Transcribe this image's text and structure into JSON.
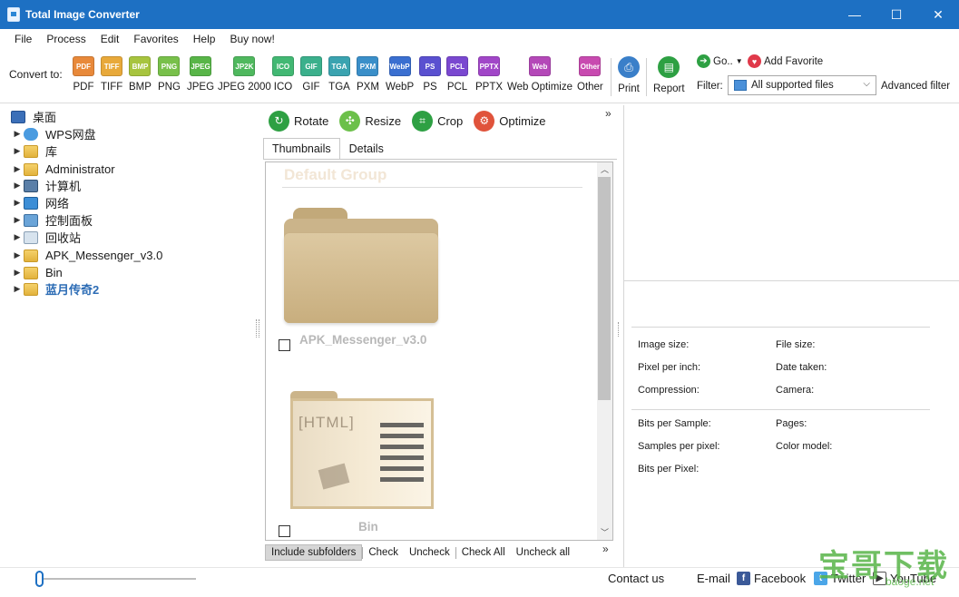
{
  "window": {
    "title": "Total Image Converter",
    "controls": {
      "minimize": "—",
      "maximize": "☐",
      "close": "✕"
    }
  },
  "menu": [
    "File",
    "Process",
    "Edit",
    "Favorites",
    "Help",
    "Buy now!"
  ],
  "toolbar": {
    "convert_label": "Convert to:",
    "formats": [
      {
        "icon_text": "PDF",
        "label": "PDF",
        "color": "#e8893a"
      },
      {
        "icon_text": "TIFF",
        "label": "TIFF",
        "color": "#e8a93a"
      },
      {
        "icon_text": "BMP",
        "label": "BMP",
        "color": "#a7c43e"
      },
      {
        "icon_text": "PNG",
        "label": "PNG",
        "color": "#78c04a"
      },
      {
        "icon_text": "JPEG",
        "label": "JPEG",
        "color": "#58b548"
      },
      {
        "icon_text": "JP2K",
        "label": "JPEG 2000",
        "color": "#4fb85e"
      },
      {
        "icon_text": "ICO",
        "label": "ICO",
        "color": "#42b873"
      },
      {
        "icon_text": "GIF",
        "label": "GIF",
        "color": "#3bb08c"
      },
      {
        "icon_text": "TGA",
        "label": "TGA",
        "color": "#3aa3b0"
      },
      {
        "icon_text": "PXM",
        "label": "PXM",
        "color": "#3a8fc9"
      },
      {
        "icon_text": "WebP",
        "label": "WebP",
        "color": "#3a6fd0"
      },
      {
        "icon_text": "PS",
        "label": "PS",
        "color": "#5a50d0"
      },
      {
        "icon_text": "PCL",
        "label": "PCL",
        "color": "#7a48d0"
      },
      {
        "icon_text": "PPTX",
        "label": "PPTX",
        "color": "#a146c8"
      },
      {
        "icon_text": "Web",
        "label": "Web Optimize",
        "color": "#b448b8"
      },
      {
        "icon_text": "Other",
        "label": "Other",
        "color": "#c84ab0"
      }
    ],
    "print_label": "Print",
    "report_label": "Report",
    "go_label": "Go..",
    "add_favorite_label": "Add Favorite",
    "filter_label": "Filter:",
    "filter_value": "All supported files",
    "advanced_filter_label": "Advanced filter"
  },
  "tree": [
    {
      "label": "桌面",
      "icon": "desktop-icon",
      "expandable": false,
      "highlight": false
    },
    {
      "label": "WPS网盘",
      "icon": "cloud-icon",
      "expandable": true,
      "highlight": false
    },
    {
      "label": "库",
      "icon": "library-icon",
      "expandable": true,
      "highlight": false
    },
    {
      "label": "Administrator",
      "icon": "user-folder-icon",
      "expandable": true,
      "highlight": false
    },
    {
      "label": "计算机",
      "icon": "computer-icon",
      "expandable": true,
      "highlight": false
    },
    {
      "label": "网络",
      "icon": "network-icon",
      "expandable": true,
      "highlight": false
    },
    {
      "label": "控制面板",
      "icon": "control-panel-icon",
      "expandable": true,
      "highlight": false
    },
    {
      "label": "回收站",
      "icon": "recycle-bin-icon",
      "expandable": true,
      "highlight": false
    },
    {
      "label": "APK_Messenger_v3.0",
      "icon": "folder-icon",
      "expandable": true,
      "highlight": false
    },
    {
      "label": "Bin",
      "icon": "folder-icon",
      "expandable": true,
      "highlight": false
    },
    {
      "label": "蓝月传奇2",
      "icon": "folder-icon",
      "expandable": true,
      "highlight": true
    }
  ],
  "actions": [
    {
      "label": "Rotate",
      "icon": "rotate-icon",
      "color": "#2ea043"
    },
    {
      "label": "Resize",
      "icon": "resize-icon",
      "color": "#6cc04a"
    },
    {
      "label": "Crop",
      "icon": "crop-icon",
      "color": "#2ea043"
    },
    {
      "label": "Optimize",
      "icon": "optimize-icon",
      "color": "#e0533b"
    }
  ],
  "more_symbol": "»",
  "tabs": [
    "Thumbnails",
    "Details"
  ],
  "thumbnails": {
    "group_title": "Default Group",
    "items": [
      {
        "name": "APK_Messenger_v3.0"
      },
      {
        "name": "Bin"
      }
    ],
    "doc_text": "[HTML]"
  },
  "bottom_actions": [
    "Include subfolders",
    "Check",
    "Uncheck",
    "Check All",
    "Uncheck all"
  ],
  "info": {
    "image_size": "Image size:",
    "file_size": "File size:",
    "ppi": "Pixel per inch:",
    "date_taken": "Date taken:",
    "compression": "Compression:",
    "camera": "Camera:",
    "bits_per_sample": "Bits per Sample:",
    "pages": "Pages:",
    "samples_per_pixel": "Samples per pixel:",
    "color_model": "Color model:",
    "bits_per_pixel": "Bits per Pixel:"
  },
  "status": {
    "contact": "Contact us",
    "email": "E-mail",
    "facebook": "Facebook",
    "twitter": "Twitter",
    "youtube": "YouTube"
  },
  "watermark": {
    "text": "宝哥下载",
    "sub": "baoge.net"
  }
}
